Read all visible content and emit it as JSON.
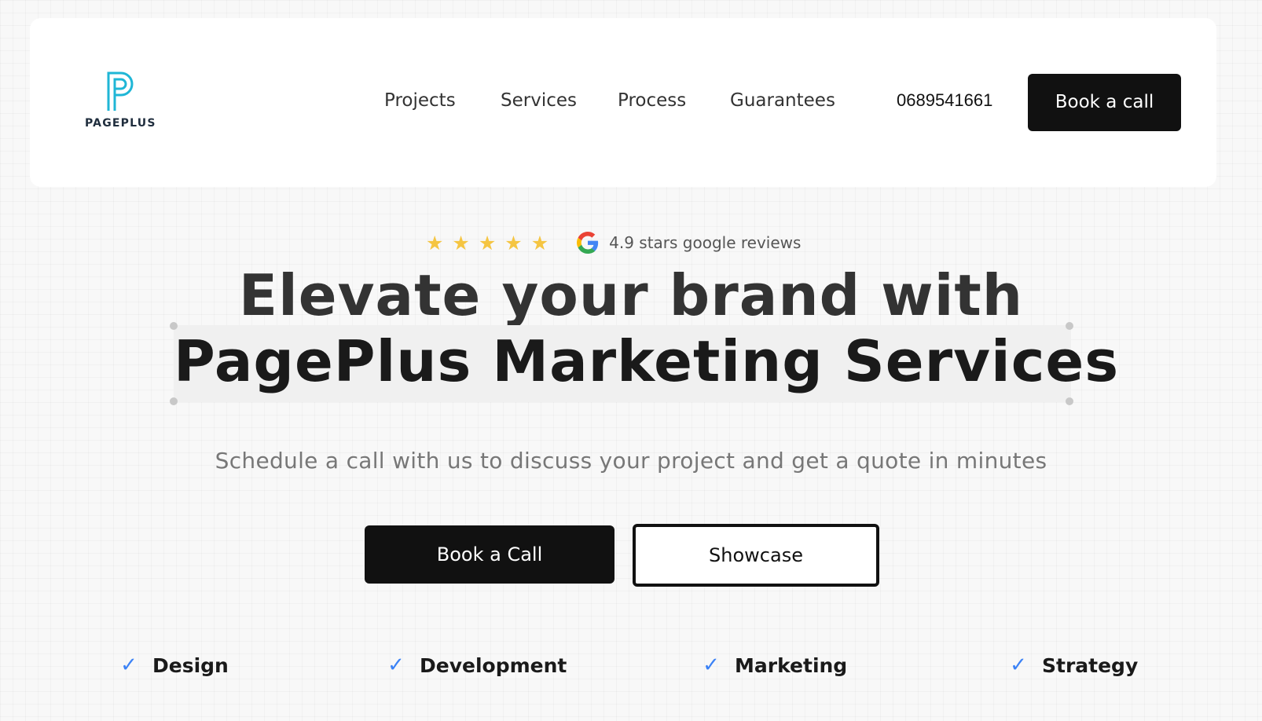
{
  "brand": {
    "name": "PAGEPLUS",
    "accent_color": "#1fb6d6"
  },
  "nav": {
    "links": [
      "Projects",
      "Services",
      "Process",
      "Guarantees"
    ],
    "phone": "0689541661",
    "cta_label": "Book a call"
  },
  "rating": {
    "stars": 5,
    "text": "4.9 stars google reviews",
    "icons": [
      "star-icon",
      "google-icon"
    ]
  },
  "hero": {
    "headline_line1": "Elevate your brand with",
    "headline_line2": "PagePlus Marketing Services",
    "subheadline": "Schedule a call with us to discuss your project and get a quote in minutes",
    "primary_cta": "Book a Call",
    "secondary_cta": "Showcase"
  },
  "features": [
    "Design",
    "Development",
    "Marketing",
    "Strategy"
  ]
}
